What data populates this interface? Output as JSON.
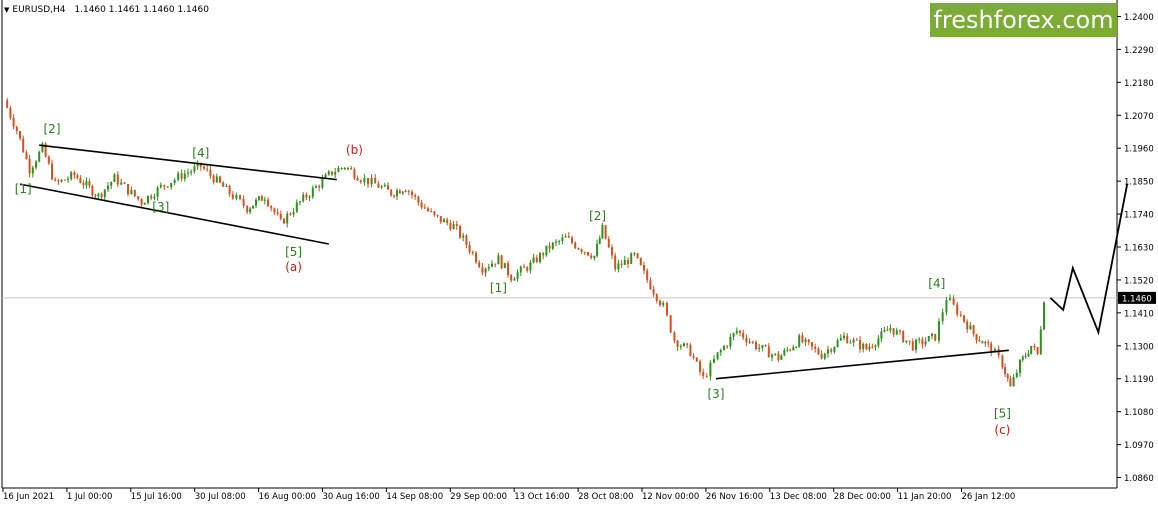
{
  "window": {
    "symbol_label": "EURUSD,H4",
    "ohlc": "1.1460 1.1461 1.1460 1.1460",
    "menu_icon": "triangle-down-icon"
  },
  "logo": {
    "text": "freshforex.com",
    "background": "#7cab36",
    "text_color": "#ffffff"
  },
  "colors": {
    "bull_candle": "#2f8f1f",
    "bear_candle": "#d2521e",
    "trendline": "#000000",
    "wave_label_green": "#2e7d1e",
    "wave_label_red": "#d01818",
    "price_line": "#c8c8c8",
    "axis": "#000000"
  },
  "chart_data": {
    "type": "candlestick",
    "symbol": "EURUSD",
    "timeframe": "H4",
    "last_price": "1.1460",
    "ylim": [
      1.0825,
      1.2455
    ],
    "y_ticks": [
      "1.2400",
      "1.2290",
      "1.2180",
      "1.2070",
      "1.1960",
      "1.1850",
      "1.1740",
      "1.1630",
      "1.1520",
      "1.1410",
      "1.1300",
      "1.1190",
      "1.1080",
      "1.0970",
      "1.0860"
    ],
    "x_tick_labels": [
      "16 Jun 2021",
      "1 Jul 00:00",
      "15 Jul 16:00",
      "30 Jul 08:00",
      "16 Aug 00:00",
      "30 Aug 16:00",
      "14 Sep 08:00",
      "29 Sep 00:00",
      "13 Oct 16:00",
      "28 Oct 08:00",
      "12 Nov 00:00",
      "26 Nov 16:00",
      "13 Dec 08:00",
      "28 Dec 00:00",
      "11 Jan 20:00",
      "26 Jan 12:00"
    ],
    "price_path": [
      {
        "x": 0.0,
        "y": 1.212
      },
      {
        "x": 0.8,
        "y": 1.202
      },
      {
        "x": 1.6,
        "y": 1.189
      },
      {
        "x": 2.4,
        "y": 1.196
      },
      {
        "x": 3.2,
        "y": 1.184
      },
      {
        "x": 4.4,
        "y": 1.187
      },
      {
        "x": 5.9,
        "y": 1.18
      },
      {
        "x": 6.9,
        "y": 1.186
      },
      {
        "x": 8.6,
        "y": 1.178
      },
      {
        "x": 9.8,
        "y": 1.183
      },
      {
        "x": 11.1,
        "y": 1.187
      },
      {
        "x": 12.3,
        "y": 1.19
      },
      {
        "x": 13.5,
        "y": 1.184
      },
      {
        "x": 14.3,
        "y": 1.18
      },
      {
        "x": 15.2,
        "y": 1.176
      },
      {
        "x": 16.3,
        "y": 1.18
      },
      {
        "x": 17.3,
        "y": 1.171
      },
      {
        "x": 18.3,
        "y": 1.177
      },
      {
        "x": 19.5,
        "y": 1.183
      },
      {
        "x": 20.5,
        "y": 1.188
      },
      {
        "x": 21.3,
        "y": 1.19
      },
      {
        "x": 22.3,
        "y": 1.186
      },
      {
        "x": 23.2,
        "y": 1.184
      },
      {
        "x": 24.2,
        "y": 1.181
      },
      {
        "x": 25.1,
        "y": 1.183
      },
      {
        "x": 25.9,
        "y": 1.178
      },
      {
        "x": 26.9,
        "y": 1.173
      },
      {
        "x": 28.1,
        "y": 1.17
      },
      {
        "x": 28.9,
        "y": 1.164
      },
      {
        "x": 29.9,
        "y": 1.156
      },
      {
        "x": 30.9,
        "y": 1.159
      },
      {
        "x": 31.7,
        "y": 1.153
      },
      {
        "x": 32.9,
        "y": 1.157
      },
      {
        "x": 34.1,
        "y": 1.163
      },
      {
        "x": 35.1,
        "y": 1.166
      },
      {
        "x": 35.9,
        "y": 1.163
      },
      {
        "x": 36.9,
        "y": 1.16
      },
      {
        "x": 37.4,
        "y": 1.169
      },
      {
        "x": 38.2,
        "y": 1.156
      },
      {
        "x": 39.4,
        "y": 1.16
      },
      {
        "x": 40.2,
        "y": 1.152
      },
      {
        "x": 41.2,
        "y": 1.143
      },
      {
        "x": 41.9,
        "y": 1.132
      },
      {
        "x": 42.9,
        "y": 1.128
      },
      {
        "x": 43.7,
        "y": 1.119
      },
      {
        "x": 44.6,
        "y": 1.127
      },
      {
        "x": 45.8,
        "y": 1.135
      },
      {
        "x": 47.0,
        "y": 1.13
      },
      {
        "x": 48.4,
        "y": 1.126
      },
      {
        "x": 49.7,
        "y": 1.132
      },
      {
        "x": 51.1,
        "y": 1.127
      },
      {
        "x": 52.5,
        "y": 1.133
      },
      {
        "x": 53.9,
        "y": 1.129
      },
      {
        "x": 55.4,
        "y": 1.136
      },
      {
        "x": 56.8,
        "y": 1.13
      },
      {
        "x": 58.2,
        "y": 1.133
      },
      {
        "x": 58.9,
        "y": 1.146
      },
      {
        "x": 59.8,
        "y": 1.14
      },
      {
        "x": 60.6,
        "y": 1.134
      },
      {
        "x": 61.7,
        "y": 1.129
      },
      {
        "x": 62.4,
        "y": 1.124
      },
      {
        "x": 62.9,
        "y": 1.116
      },
      {
        "x": 63.5,
        "y": 1.124
      },
      {
        "x": 64.2,
        "y": 1.13
      },
      {
        "x": 64.6,
        "y": 1.127
      },
      {
        "x": 65.0,
        "y": 1.146
      }
    ],
    "trendlines": [
      {
        "from": {
          "x": 2.2,
          "y": 1.197
        },
        "to": {
          "x": 20.8,
          "y": 1.1855
        }
      },
      {
        "from": {
          "x": 1.0,
          "y": 1.184
        },
        "to": {
          "x": 20.3,
          "y": 1.164
        }
      },
      {
        "from": {
          "x": 44.5,
          "y": 1.119
        },
        "to": {
          "x": 62.8,
          "y": 1.1285
        }
      }
    ],
    "forecast_path": [
      {
        "x": 65.4,
        "y": 1.146
      },
      {
        "x": 66.2,
        "y": 1.142
      },
      {
        "x": 66.8,
        "y": 1.156
      },
      {
        "x": 68.4,
        "y": 1.1345
      },
      {
        "x": 70.2,
        "y": 1.184
      }
    ],
    "wave_labels": [
      {
        "text": "[1]",
        "x": 1.2,
        "y": 1.181,
        "color": "green"
      },
      {
        "text": "[2]",
        "x": 3.0,
        "y": 1.201,
        "color": "green"
      },
      {
        "text": "[3]",
        "x": 9.8,
        "y": 1.175,
        "color": "green"
      },
      {
        "text": "[4]",
        "x": 12.3,
        "y": 1.193,
        "color": "green"
      },
      {
        "text": "[5]",
        "x": 18.1,
        "y": 1.16,
        "color": "green"
      },
      {
        "text": "(a)",
        "x": 18.1,
        "y": 1.155,
        "color": "red"
      },
      {
        "text": "(b)",
        "x": 21.9,
        "y": 1.194,
        "color": "red"
      },
      {
        "text": "[1]",
        "x": 30.9,
        "y": 1.148,
        "color": "green"
      },
      {
        "text": "[2]",
        "x": 37.1,
        "y": 1.172,
        "color": "green"
      },
      {
        "text": "[3]",
        "x": 44.5,
        "y": 1.1125,
        "color": "green"
      },
      {
        "text": "[4]",
        "x": 58.3,
        "y": 1.1495,
        "color": "green"
      },
      {
        "text": "[5]",
        "x": 62.4,
        "y": 1.106,
        "color": "green"
      },
      {
        "text": "(c)",
        "x": 62.4,
        "y": 1.1005,
        "color": "red"
      }
    ],
    "grid": false
  }
}
